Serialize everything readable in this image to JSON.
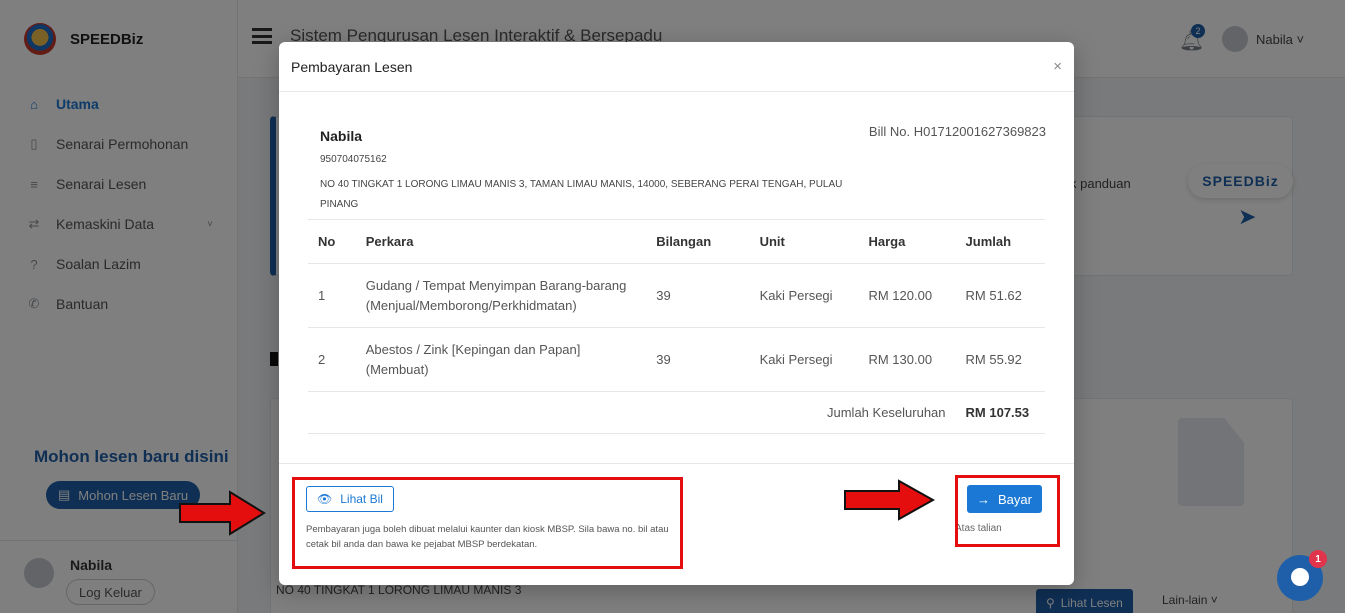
{
  "app": {
    "brand": "SPEEDBiz",
    "topbar_title": "Sistem Pengurusan Lesen Interaktif & Bersepadu",
    "notification_count": "2",
    "user_menu": "Nabila ˅"
  },
  "sidebar": {
    "items": [
      {
        "label": "Utama",
        "icon": "home-icon"
      },
      {
        "label": "Senarai Permohonan",
        "icon": "file-icon"
      },
      {
        "label": "Senarai Lesen",
        "icon": "list-icon"
      },
      {
        "label": "Kemaskini Data",
        "icon": "refresh-icon"
      },
      {
        "label": "Soalan Lazim",
        "icon": "help-icon"
      },
      {
        "label": "Bantuan",
        "icon": "phone-icon"
      }
    ],
    "promo_text": "Mohon lesen baru disini",
    "promo_button": "Mohon Lesen Baru",
    "user_name": "Nabila",
    "logout": "Log Keluar"
  },
  "background": {
    "card_text": "k panduan",
    "logo_text": "SPEEDBiz",
    "address": "NO 40 TINGKAT 1 LORONG LIMAU MANIS 3",
    "lihat_lesen": "Lihat Lesen",
    "lain_lain": "Lain-lain ˅",
    "chat_badge": "1"
  },
  "modal": {
    "title": "Pembayaran Lesen",
    "close": "×",
    "customer_name": "Nabila",
    "bill_no": "Bill No. H01712001627369823",
    "ic_no": "950704075162",
    "address": "NO 40 TINGKAT 1 LORONG LIMAU MANIS 3, TAMAN LIMAU MANIS, 14000, SEBERANG PERAI TENGAH, PULAU PINANG",
    "columns": [
      "No",
      "Perkara",
      "Bilangan",
      "Unit",
      "Harga",
      "Jumlah"
    ],
    "rows": [
      {
        "no": "1",
        "perkara": "Gudang / Tempat Menyimpan Barang-barang (Menjual/Memborong/Perkhidmatan)",
        "bilangan": "39",
        "unit": "Kaki Persegi",
        "harga": "RM 120.00",
        "jumlah": "RM 51.62"
      },
      {
        "no": "2",
        "perkara": "Abestos / Zink [Kepingan dan Papan] (Membuat)",
        "bilangan": "39",
        "unit": "Kaki Persegi",
        "harga": "RM 130.00",
        "jumlah": "RM 55.92"
      }
    ],
    "total_label": "Jumlah Keseluruhan",
    "total_value": "RM 107.53",
    "lihat_bil": "Lihat Bil",
    "note": "Pembayaran juga boleh dibuat melalui kaunter dan kiosk MBSP. Sila bawa no. bil atau cetak bil anda dan bawa ke pejabat MBSP berdekatan.",
    "bayar": "Bayar",
    "atas_talian": "Atas talian"
  },
  "colors": {
    "primary": "#1b78d4",
    "brand_dark": "#1f5fa9",
    "annotation_red": "#e50e0e"
  }
}
